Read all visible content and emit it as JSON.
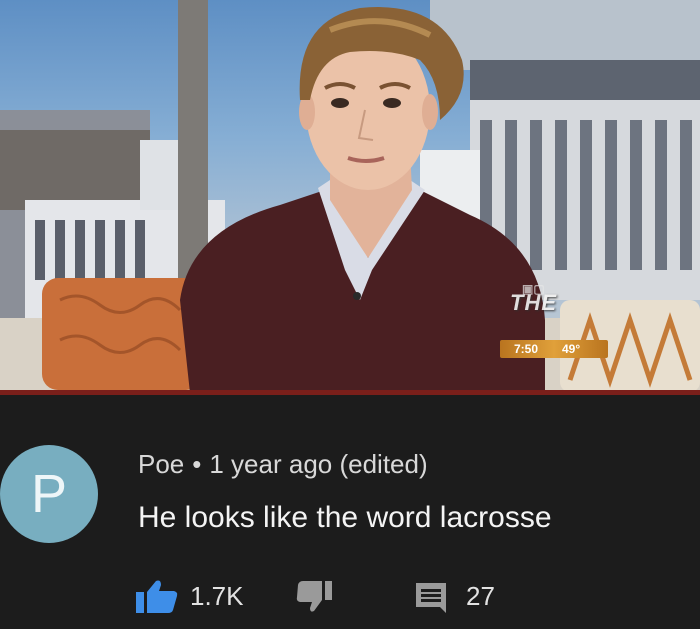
{
  "station_bug": {
    "logo": "THE",
    "time": "7:50",
    "temp": "49°"
  },
  "comment": {
    "avatar_letter": "P",
    "avatar_color": "#78aec0",
    "author": "Poe",
    "separator": "•",
    "timestamp": "1 year ago (edited)",
    "text": "He looks like the word lacrosse",
    "like_count": "1.7K",
    "reply_count": "27",
    "like_icon_color": "#3e8ee8"
  }
}
